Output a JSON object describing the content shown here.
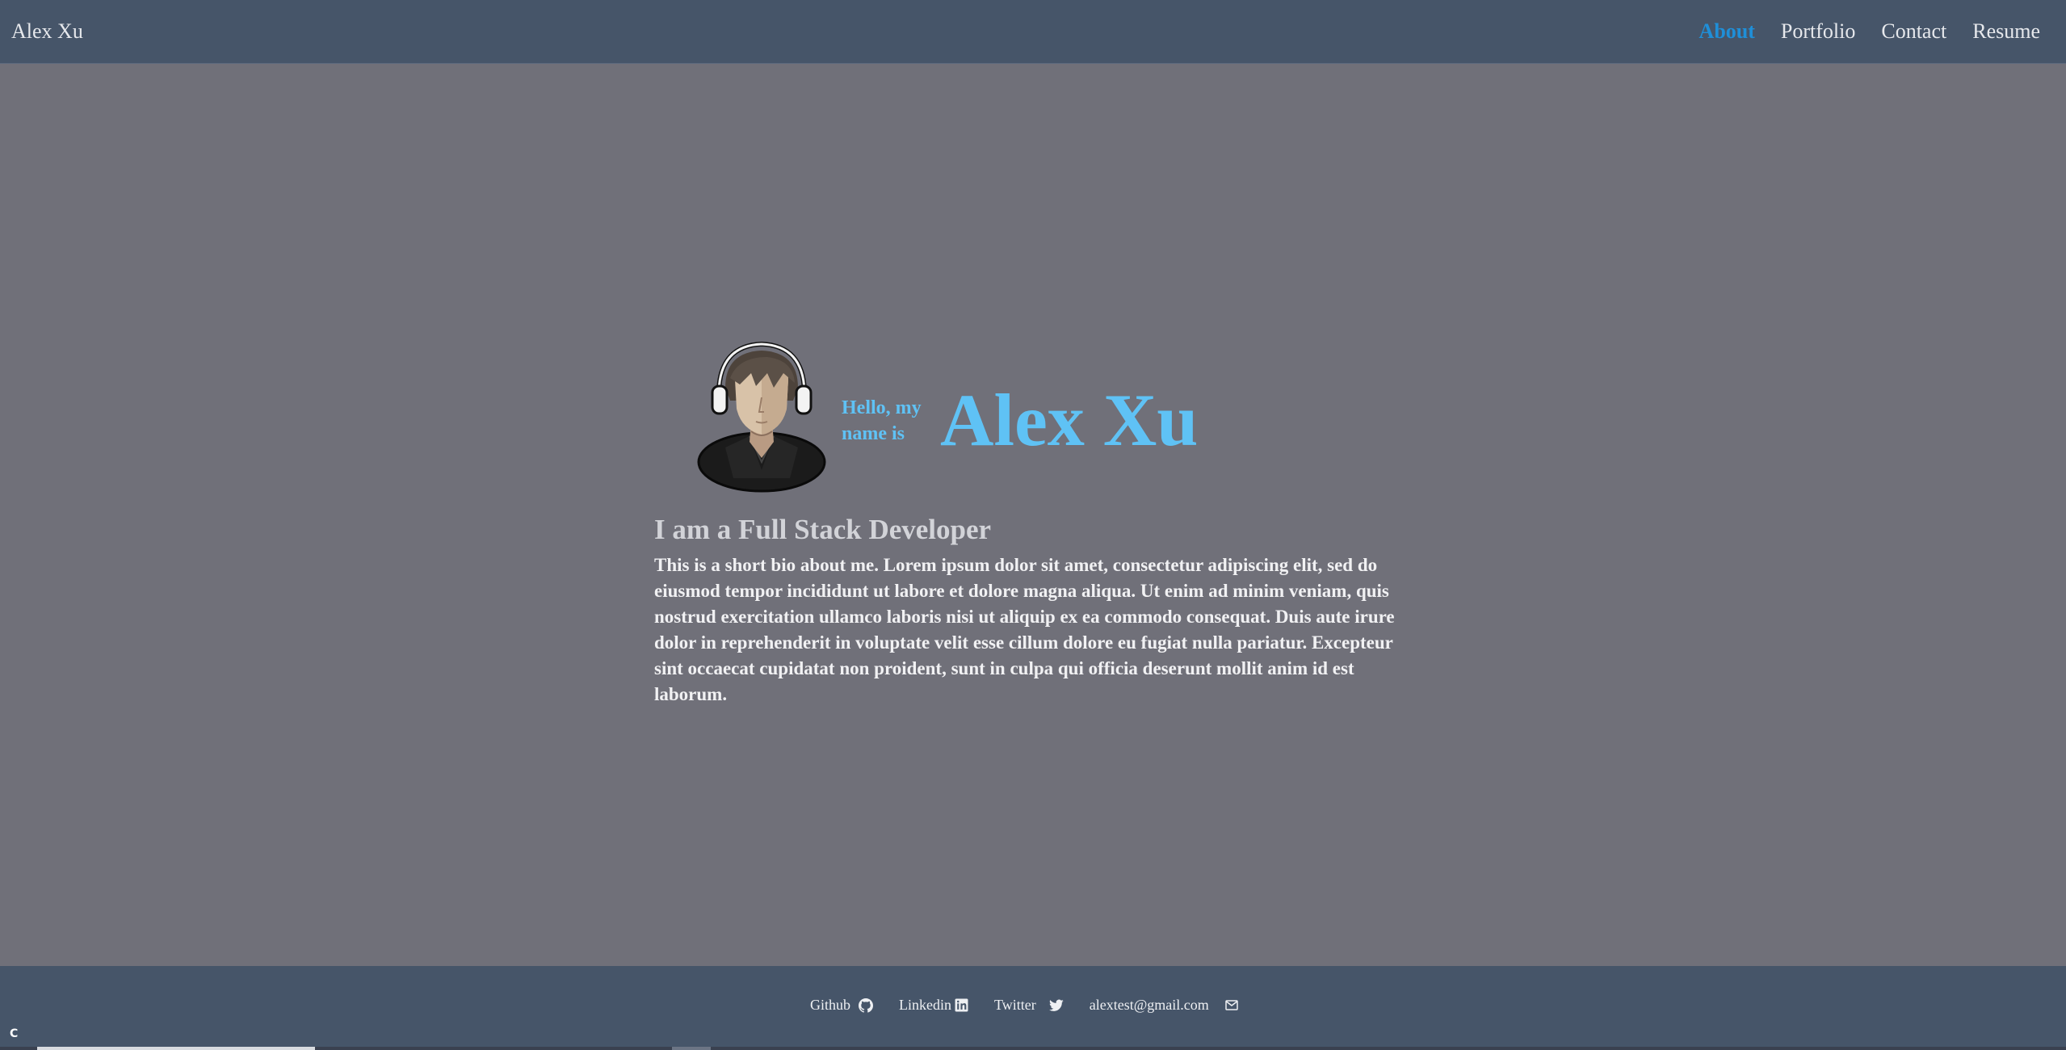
{
  "header": {
    "brand": "Alex Xu",
    "nav": [
      {
        "label": "About",
        "active": true
      },
      {
        "label": "Portfolio",
        "active": false
      },
      {
        "label": "Contact",
        "active": false
      },
      {
        "label": "Resume",
        "active": false
      }
    ]
  },
  "hero": {
    "greeting": "Hello, my name is",
    "name": "Alex Xu",
    "role": "I am a Full Stack Developer",
    "bio": "This is a short bio about me. Lorem ipsum dolor sit amet, consectetur adipiscing elit, sed do eiusmod tempor incididunt ut labore et dolore magna aliqua. Ut enim ad minim veniam, quis nostrud exercitation ullamco laboris nisi ut aliquip ex ea commodo consequat. Duis aute irure dolor in reprehenderit in voluptate velit esse cillum dolore eu fugiat nulla pariatur. Excepteur sint occaecat cupidatat non proident, sunt in culpa qui officia deserunt mollit anim id est laborum."
  },
  "footer": {
    "links": [
      {
        "label": "Github",
        "icon": "github-icon"
      },
      {
        "label": "Linkedin",
        "icon": "linkedin-icon"
      },
      {
        "label": "Twitter",
        "icon": "twitter-icon"
      },
      {
        "label": "alextest@gmail.com",
        "icon": "envelope-icon"
      }
    ]
  },
  "taskbar": {
    "glyph": "C"
  },
  "colors": {
    "header_bg": "#465569",
    "page_bg": "#707079",
    "accent": "#5fc2f5",
    "nav_active": "#1f8fd8"
  }
}
